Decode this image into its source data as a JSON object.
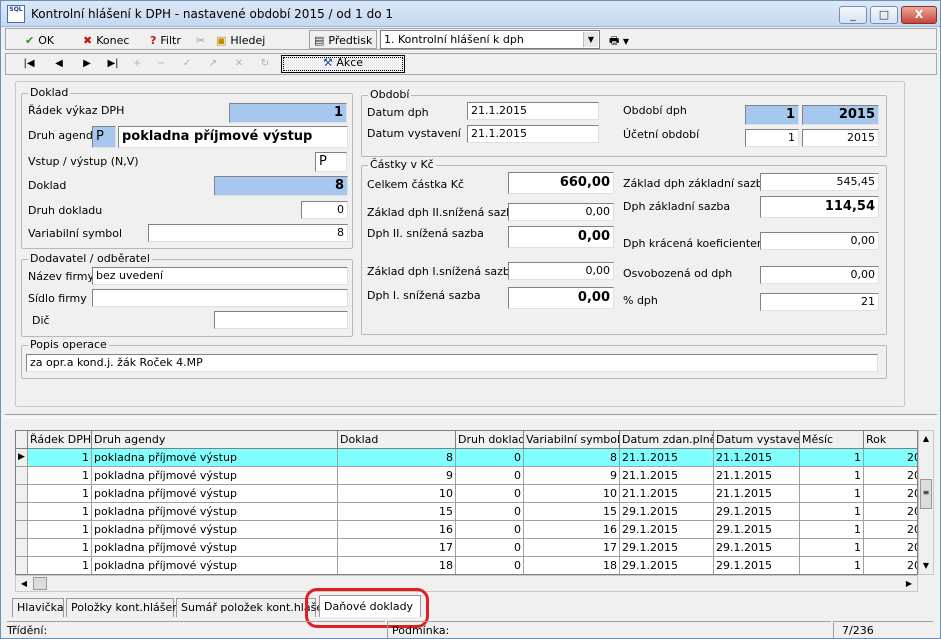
{
  "window": {
    "title": "Kontrolní hlášení k DPH - nastavené období 2015 / od 1 do 1",
    "logo_text": "SQL",
    "controls": [
      "_",
      "□",
      "X"
    ]
  },
  "toolbar": {
    "ok_label": "OK",
    "konec_label": "Konec",
    "filtr_label": "Filtr",
    "hledej_label": "Hledej",
    "predtisk_label": "Předtisk",
    "report_select": "1. Kontrolní hlášení k dph"
  },
  "nav": {
    "buttons": [
      "|◀",
      "◀",
      "▶",
      "▶|",
      "+",
      "−",
      "✓",
      "↗",
      "✕",
      "↻"
    ],
    "akce_label": "Akce"
  },
  "doklad": {
    "group_label": "Doklad",
    "radek_label": "Řádek výkaz DPH",
    "radek_value": "1",
    "druh_agendy_label": "Druh agendy",
    "druh_agendy_code": "P",
    "druh_agendy_value": "pokladna příjmové výstup",
    "vstup_label": "Vstup / výstup (N,V)",
    "vstup_value": "P",
    "doklad_label": "Doklad",
    "doklad_value": "8",
    "druh_dokladu_label": "Druh dokladu",
    "druh_dokladu_value": "0",
    "var_symbol_label": "Variabilní symbol",
    "var_symbol_value": "8"
  },
  "dodavatel": {
    "group_label": "Dodavatel / odběratel",
    "nazev_label": "Název firmy",
    "nazev_value": "bez uvedení",
    "sidlo_label": "Sídlo firmy",
    "sidlo_value": "",
    "dic_label": "Dič",
    "dic_value": ""
  },
  "obdobi": {
    "group_label": "Období",
    "datum_dph_label": "Datum dph",
    "datum_dph_value": "21.1.2015",
    "datum_vyst_label": "Datum vystavení",
    "datum_vyst_value": "21.1.2015",
    "obdobi_dph_label": "Období dph",
    "obdobi_dph_month": "1",
    "obdobi_dph_year": "2015",
    "ucetni_label": "Účetní období",
    "ucetni_month": "1",
    "ucetni_year": "2015"
  },
  "castky": {
    "group_label": "Částky v Kč",
    "celkem_label": "Celkem částka Kč",
    "celkem_value": "660,00",
    "zaklad_ii_label": "Základ dph II.snížená sazba",
    "zaklad_ii_value": "0,00",
    "dph_ii_label": "Dph II. snížená sazba",
    "dph_ii_value": "0,00",
    "zaklad_i_label": "Základ dph I.snížená sazba",
    "zaklad_i_value": "0,00",
    "dph_i_label": "Dph I. snížená sazba",
    "dph_i_value": "0,00",
    "zaklad_zakl_label": "Základ dph základní sazba",
    "zaklad_zakl_value": "545,45",
    "dph_zakl_label": "Dph základní sazba",
    "dph_zakl_value": "114,54",
    "krac_label": "Dph krácená koeficientem",
    "krac_value": "0,00",
    "osvob_label": "Osvobozená od dph",
    "osvob_value": "0,00",
    "proc_label": "% dph",
    "proc_value": "21"
  },
  "popis": {
    "group_label": "Popis operace",
    "value": "za opr.a kond.j. žák Roček 4.MP"
  },
  "grid": {
    "columns": [
      "Řádek DPH",
      "Druh agendy",
      "Doklad",
      "Druh dokladu",
      "Variabilní symbol",
      "Datum zdan.plnění",
      "Datum vystavení",
      "Měsíc",
      "Rok"
    ],
    "rows": [
      [
        "1",
        "pokladna příjmové výstup",
        "8",
        "0",
        "8",
        "21.1.2015",
        "21.1.2015",
        "1",
        "20"
      ],
      [
        "1",
        "pokladna příjmové výstup",
        "9",
        "0",
        "9",
        "21.1.2015",
        "21.1.2015",
        "1",
        "20"
      ],
      [
        "1",
        "pokladna příjmové výstup",
        "10",
        "0",
        "10",
        "21.1.2015",
        "21.1.2015",
        "1",
        "20"
      ],
      [
        "1",
        "pokladna příjmové výstup",
        "15",
        "0",
        "15",
        "29.1.2015",
        "29.1.2015",
        "1",
        "20"
      ],
      [
        "1",
        "pokladna příjmové výstup",
        "16",
        "0",
        "16",
        "29.1.2015",
        "29.1.2015",
        "1",
        "20"
      ],
      [
        "1",
        "pokladna příjmové výstup",
        "17",
        "0",
        "17",
        "29.1.2015",
        "29.1.2015",
        "1",
        "20"
      ],
      [
        "1",
        "pokladna příjmové výstup",
        "18",
        "0",
        "18",
        "29.1.2015",
        "29.1.2015",
        "1",
        "20"
      ]
    ],
    "selected_row": 0
  },
  "tabs": [
    "Hlavička",
    "Položky kont.hlášení",
    "Sumář položek kont.hlášení",
    "Daňové doklady"
  ],
  "active_tab": 3,
  "status": {
    "trideni_label": "Třídění:",
    "podminka_label": "Podmínka:",
    "record_count": "7/236"
  },
  "colors": {
    "highlight_field": "#a6c8ee",
    "selected_row": "#80ffff",
    "annotation_red": "#e02020"
  }
}
